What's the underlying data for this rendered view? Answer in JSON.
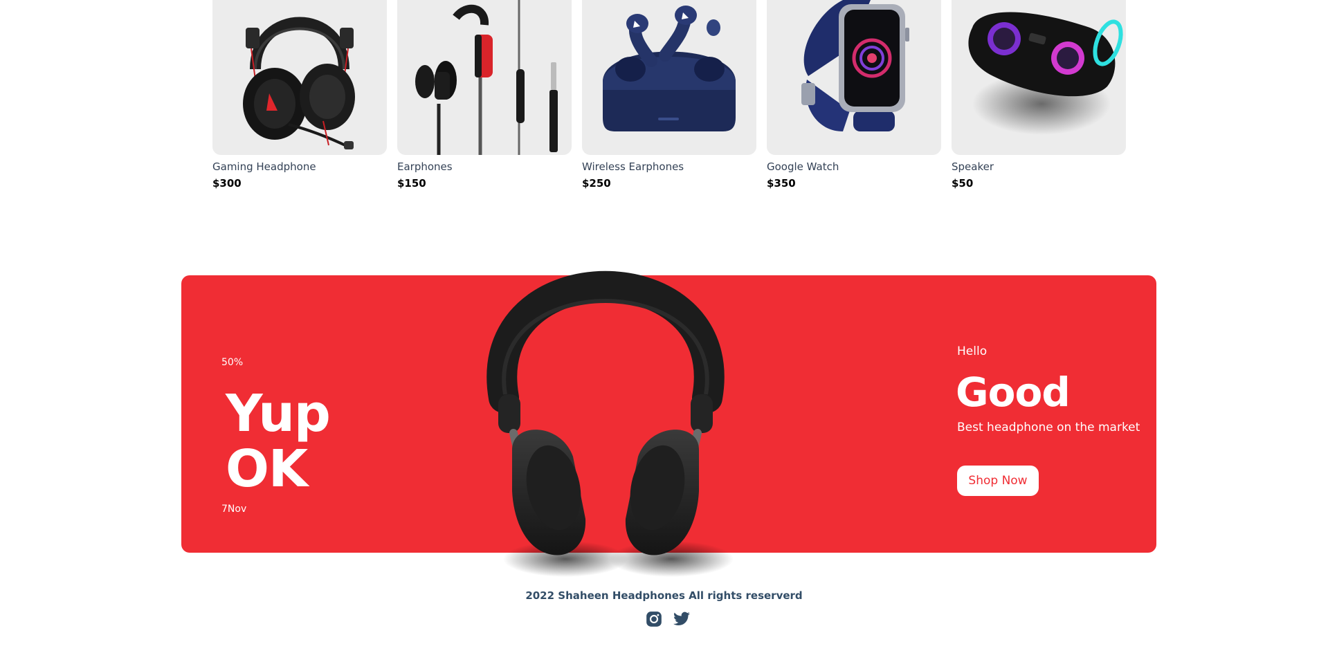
{
  "products": [
    {
      "name": "Gaming Headphone",
      "price": "$300",
      "icon": "gaming-headphone-image"
    },
    {
      "name": "Earphones",
      "price": "$150",
      "icon": "earphones-image"
    },
    {
      "name": "Wireless Earphones",
      "price": "$250",
      "icon": "wireless-earphones-image"
    },
    {
      "name": "Google Watch",
      "price": "$350",
      "icon": "smart-watch-image"
    },
    {
      "name": "Speaker",
      "price": "$50",
      "icon": "speaker-image"
    }
  ],
  "banner": {
    "discount": "50%",
    "large_text1": "Yup",
    "large_text2": "OK",
    "sale_time": "7Nov",
    "small_text": "Hello",
    "mid_text": "Good",
    "desc": "Best headphone on the market",
    "button": "Shop Now",
    "image": "headphones-image"
  },
  "footer": {
    "text": "2022 Shaheen Headphones All rights reserverd",
    "icons": [
      "instagram-icon",
      "twitter-icon"
    ]
  },
  "colors": {
    "accent": "#f02d34",
    "card_bg": "#ececec",
    "footer_text": "#324d67"
  }
}
